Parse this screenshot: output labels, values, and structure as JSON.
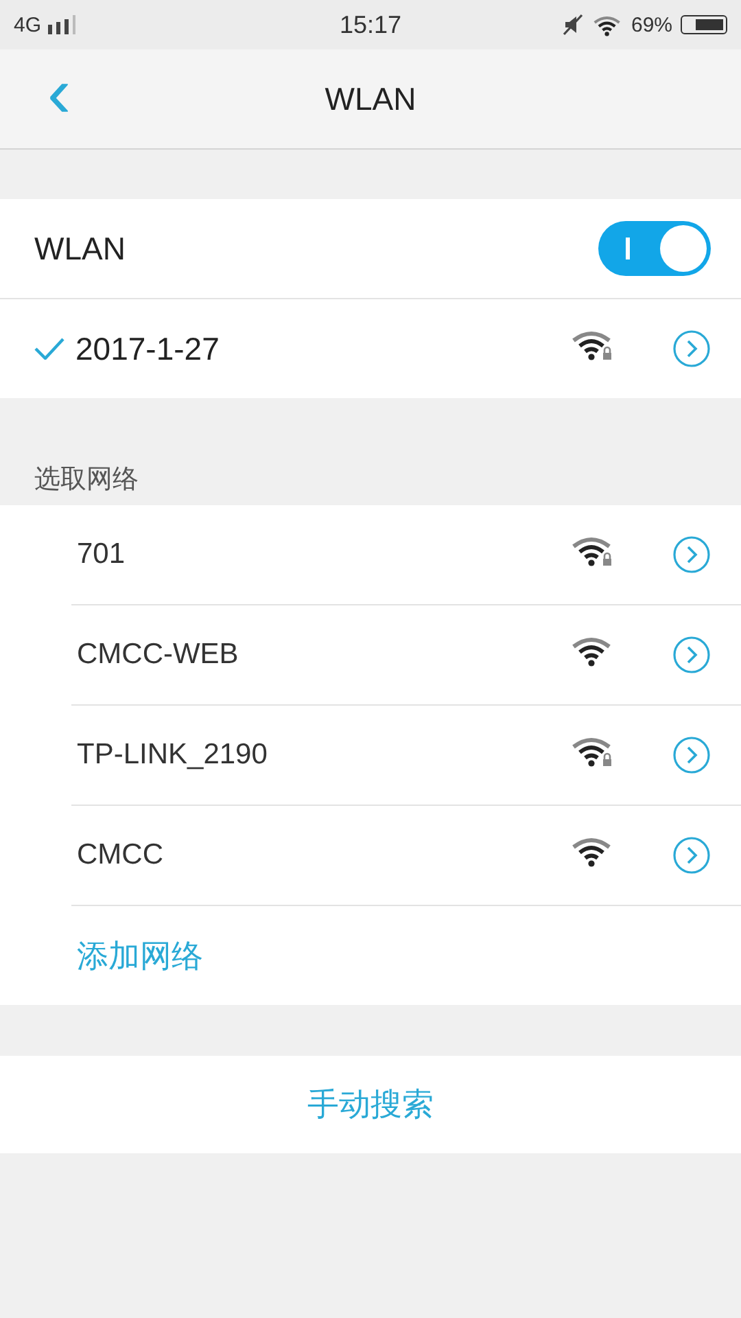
{
  "status_bar": {
    "network": "4G",
    "time": "15:17",
    "muted": true,
    "battery_text": "69%"
  },
  "header": {
    "back": "‹",
    "title": "WLAN"
  },
  "wlan": {
    "label": "WLAN",
    "on": true
  },
  "connected": {
    "name": "2017-1-27",
    "locked": true,
    "checked": true
  },
  "section_label": "选取网络",
  "networks": [
    {
      "name": "701",
      "locked": true
    },
    {
      "name": "CMCC-WEB",
      "locked": false
    },
    {
      "name": "TP-LINK_2190",
      "locked": true
    },
    {
      "name": "CMCC",
      "locked": false
    }
  ],
  "add_network": "添加网络",
  "manual_search": "手动搜索"
}
